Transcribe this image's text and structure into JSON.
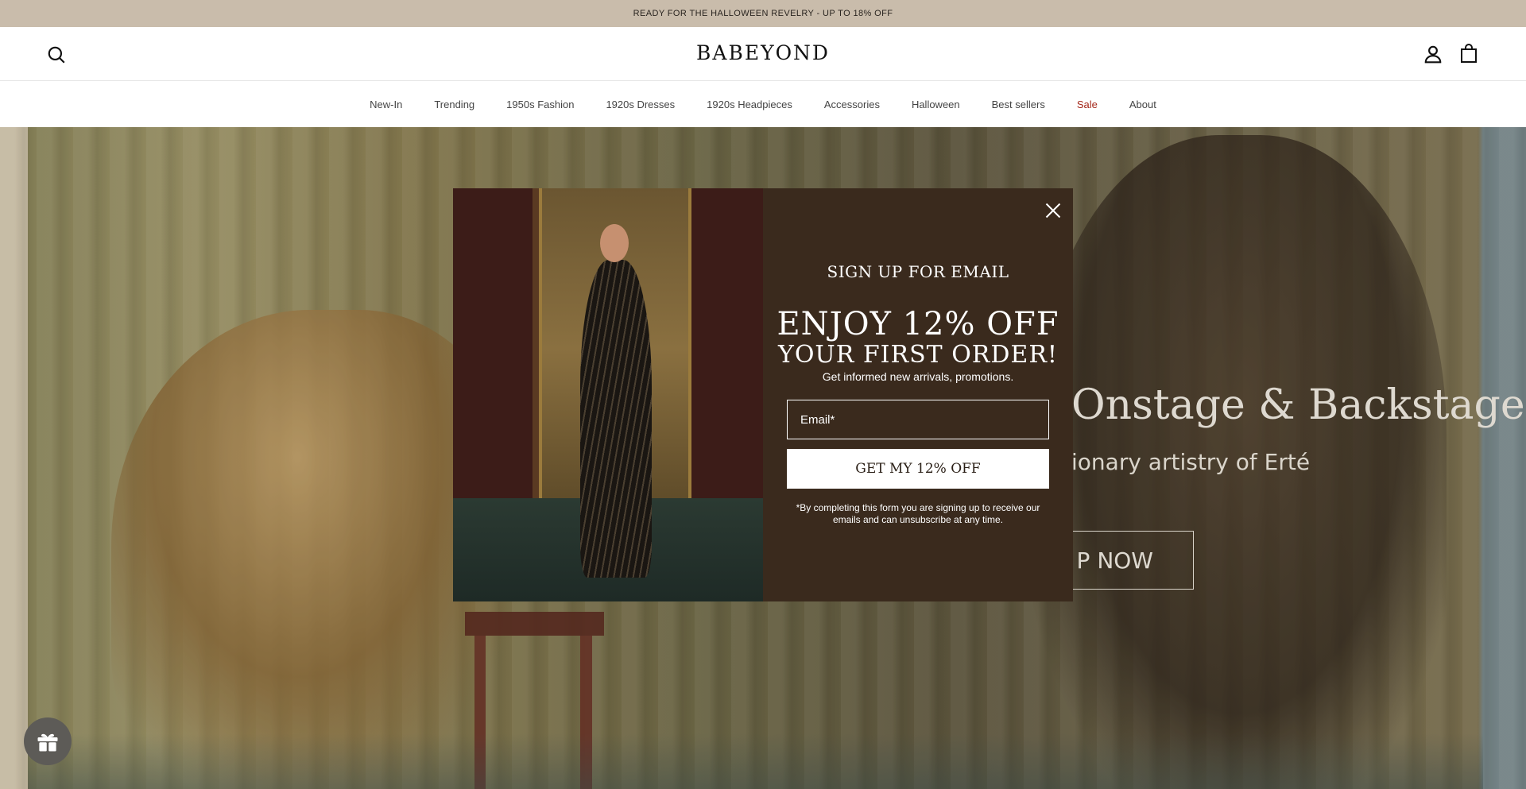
{
  "announcement": {
    "text": "READY FOR THE HALLOWEEN REVELRY - UP TO 18% OFF"
  },
  "header": {
    "logo": "BABEYOND",
    "icons": {
      "search": "search-icon",
      "account": "account-icon",
      "bag": "shopping-bag-icon"
    }
  },
  "nav": {
    "items": [
      "New-In",
      "Trending",
      "1950s Fashion",
      "1920s Dresses",
      "1920s Headpieces",
      "Accessories",
      "Halloween",
      "Best sellers",
      "Sale",
      "About"
    ],
    "sale_color": "#a5281b"
  },
  "hero": {
    "headline": "Onstage & Backstage",
    "subheadline": "ionary artistry of Erté",
    "cta": "P NOW"
  },
  "modal": {
    "eyebrow": "SIGN UP FOR EMAIL",
    "headline_line1": "ENJOY 12% OFF",
    "headline_line2": "YOUR FIRST ORDER!",
    "info": "Get informed new arrivals, promotions.",
    "email_placeholder": "Email*",
    "email_value": "",
    "submit": "GET MY 12% OFF",
    "legal": "*By completing this form you are signing up to receive our emails and can unsubscribe at any time.",
    "background_color": "#3a2a1d"
  },
  "floating": {
    "gift_icon": "gift-icon"
  }
}
